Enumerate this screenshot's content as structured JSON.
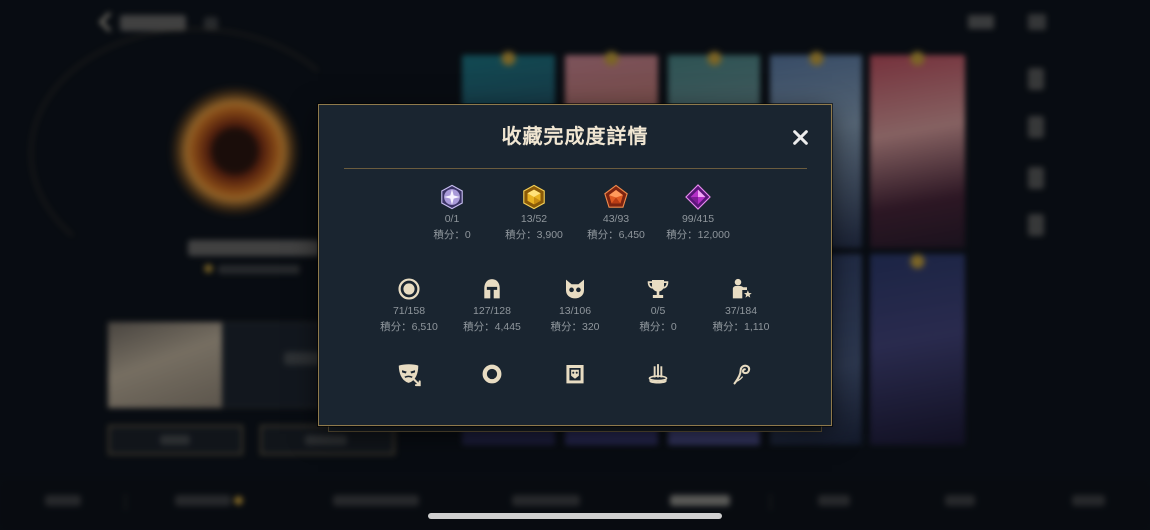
{
  "colors": {
    "backdrop": "#0c1117",
    "modal_bg": "#1a2530",
    "modal_border": "#8f7a4c",
    "title": "#f0e6d2",
    "stat_text": "#8f969c",
    "icon": "#e8dcc2"
  },
  "background": {
    "back_icon": "chevron-left-icon"
  },
  "modal": {
    "title": "收藏完成度詳情",
    "close_icon": "close-icon",
    "rarity_row": [
      {
        "icon": "white-gem-icon",
        "count": "0/1",
        "score": "積分：0"
      },
      {
        "icon": "gold-gem-icon",
        "count": "13/52",
        "score": "積分：3,900"
      },
      {
        "icon": "orange-gem-icon",
        "count": "43/93",
        "score": "積分：6,450"
      },
      {
        "icon": "purple-gem-icon",
        "count": "99/415",
        "score": "積分：12,000"
      }
    ],
    "category_row": [
      {
        "icon": "ring-target-icon",
        "count": "71/158",
        "score": "積分：6,510"
      },
      {
        "icon": "helmet-icon",
        "count": "127/128",
        "score": "積分：4,445"
      },
      {
        "icon": "cat-mask-icon",
        "count": "13/106",
        "score": "積分：320"
      },
      {
        "icon": "trophy-icon",
        "count": "0/5",
        "score": "積分：0"
      },
      {
        "icon": "person-star-icon",
        "count": "37/184",
        "score": "積分：1,110"
      }
    ],
    "icon_row": [
      {
        "icon": "theater-mask-icon"
      },
      {
        "icon": "ring-icon"
      },
      {
        "icon": "banner-frame-icon"
      },
      {
        "icon": "pedestal-icon"
      },
      {
        "icon": "swirl-icon"
      }
    ]
  }
}
